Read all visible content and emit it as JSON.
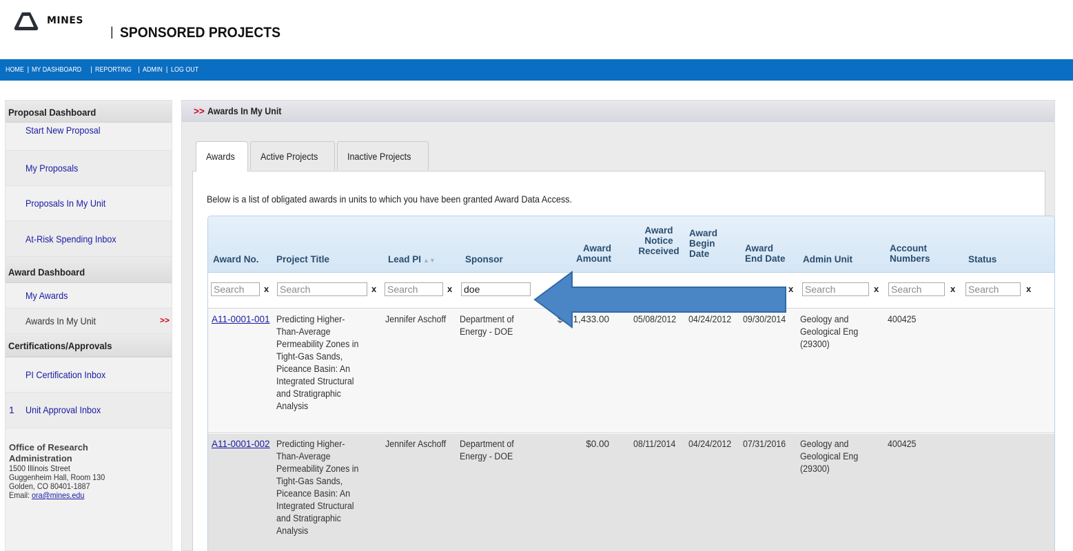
{
  "brand": {
    "logo_text": "MINES",
    "separator": "|",
    "site_title": "SPONSORED PROJECTS"
  },
  "nav": {
    "items": [
      "HOME",
      "MY DASHBOARD",
      "REPORTING",
      "ADMIN",
      "LOG OUT"
    ],
    "separator": "|"
  },
  "sidebar": {
    "proposal_heading": "Proposal Dashboard",
    "start_new_proposal": "Start New Proposal",
    "my_proposals": "My Proposals",
    "proposals_in_my_unit": "Proposals In My Unit",
    "at_risk_inbox": "At-Risk Spending Inbox",
    "award_heading": "Award Dashboard",
    "my_awards": "My Awards",
    "awards_in_my_unit": "Awards In My Unit",
    "active_marker": ">>",
    "cert_heading": "Certifications/Approvals",
    "pi_cert_inbox": "PI Certification Inbox",
    "unit_approval_count": "1",
    "unit_approval_inbox": "Unit Approval Inbox",
    "office": {
      "name_line1": "Office of Research",
      "name_line2": "Administration",
      "street": "1500 Illinois Street",
      "building": "Guggenheim Hall, Room 130",
      "city": "Golden, CO 80401-1887",
      "email_label": "Email:",
      "email": "ora@mines.edu"
    }
  },
  "main": {
    "breadcrumb_marker": ">>",
    "heading": "Awards In My Unit",
    "tabs": [
      {
        "label": "Awards",
        "active": true
      },
      {
        "label": "Active Projects",
        "active": false
      },
      {
        "label": "Inactive Projects",
        "active": false
      }
    ],
    "intro": "Below is a list of obligated awards in units to which you have been granted Award Data Access.",
    "columns": {
      "award_no": "Award No.",
      "project_title": "Project Title",
      "lead_pi": "Lead PI",
      "sponsor": "Sponsor",
      "award_amount": [
        "Award",
        "Amount"
      ],
      "notice_received": [
        "Award",
        "Notice",
        "Received"
      ],
      "begin_date": [
        "Award",
        "Begin",
        "Date"
      ],
      "end_date": [
        "Award",
        "End Date"
      ],
      "admin_unit": "Admin Unit",
      "account_numbers": [
        "Account",
        "Numbers"
      ],
      "status": "Status"
    },
    "filters": {
      "placeholder": "Search",
      "sponsor_value": "doe",
      "clear_label": "x"
    },
    "rows": [
      {
        "award_no": "A11-0001-001",
        "project_title": [
          "Predicting Higher-",
          "Than-Average",
          "Permeability Zones in",
          "Tight-Gas Sands,",
          "Piceance Basin: An",
          "Integrated Structural",
          "and Stratigraphic",
          "Analysis"
        ],
        "lead_pi": "Jennifer Aschoff",
        "sponsor": [
          "Department of",
          "Energy - DOE"
        ],
        "award_amount": "$771,433.00",
        "notice_received": "05/08/2012",
        "begin_date": "04/24/2012",
        "end_date": "09/30/2014",
        "admin_unit": [
          "Geology and",
          "Geological Eng",
          "(29300)"
        ],
        "account_numbers": "400425",
        "status": ""
      },
      {
        "award_no": "A11-0001-002",
        "project_title": [
          "Predicting Higher-",
          "Than-Average",
          "Permeability Zones in",
          "Tight-Gas Sands,",
          "Piceance Basin: An",
          "Integrated Structural",
          "and Stratigraphic",
          "Analysis"
        ],
        "lead_pi": "Jennifer Aschoff",
        "sponsor": [
          "Department of",
          "Energy - DOE"
        ],
        "award_amount": "$0.00",
        "notice_received": "08/11/2014",
        "begin_date": "04/24/2012",
        "end_date": "07/31/2016",
        "admin_unit": [
          "Geology and",
          "Geological Eng",
          "(29300)"
        ],
        "account_numbers": "400425",
        "status": ""
      }
    ]
  },
  "colors": {
    "navbar": "#0a6ec2",
    "link": "#1a1aa6",
    "marker_red": "#d0021b",
    "annotation_arrow": "#4a86c5"
  },
  "icons": {
    "logo": "mines-logo-icon",
    "sort": "sort-ascending-icon",
    "annotation": "left-arrow-annotation"
  }
}
